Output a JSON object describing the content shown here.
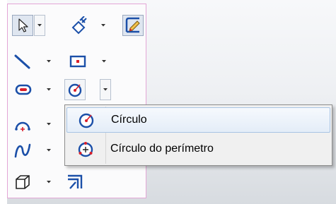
{
  "flyout": {
    "items": [
      {
        "label": "Círculo",
        "icon": "circle-center-icon",
        "selected": true
      },
      {
        "label": "Círculo do perímetro",
        "icon": "circle-perimeter-icon",
        "selected": false
      }
    ]
  },
  "colors": {
    "accent_red": "#d91f2a",
    "accent_blue": "#1b4fa8",
    "selection_bg": "#e4edf8",
    "palette_border": "#e3a6d6"
  }
}
